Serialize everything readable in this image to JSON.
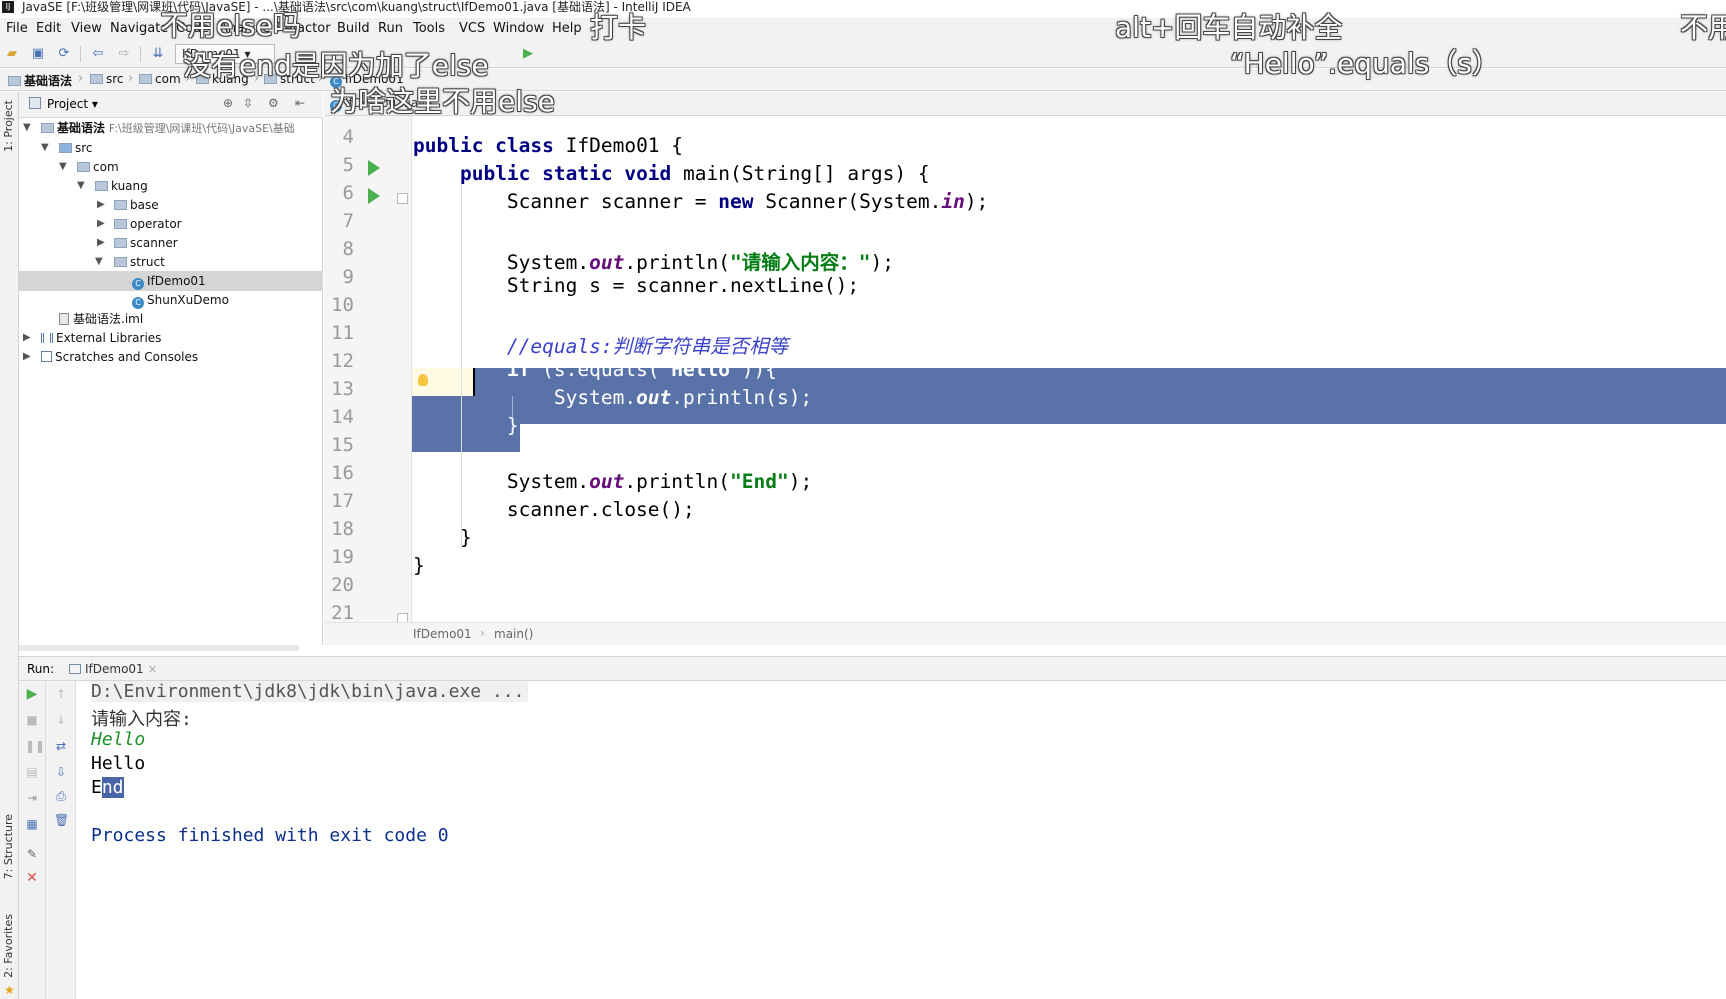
{
  "window": {
    "title": "JavaSE [F:\\班级管理\\网课班\\代码\\JavaSE] - ...\\基础语法\\src\\com\\kuang\\struct\\IfDemo01.java [基础语法] - IntelliJ IDEA"
  },
  "menu": [
    "File",
    "Edit",
    "View",
    "Navigate",
    "Code",
    "Analyze",
    "Refactor",
    "Build",
    "Run",
    "Tools",
    "VCS",
    "Window",
    "Help"
  ],
  "toolbar": {
    "run_config": "IfDemo01"
  },
  "breadcrumb": [
    "基础语法",
    "src",
    "com",
    "kuang",
    "struct",
    "IfDemo01"
  ],
  "left_tool_tabs": [
    "1: Project",
    "7: Structure",
    "2: Favorites"
  ],
  "project_panel": {
    "title": "Project",
    "tree": [
      {
        "label": "基础语法",
        "hint": "F:\\班级管理\\网课班\\代码\\JavaSE\\基础",
        "icon": "folder-icon",
        "expanded": true,
        "selected": false
      },
      {
        "label": "src",
        "hint": "",
        "icon": "folder-icon",
        "expanded": true,
        "selected": false
      },
      {
        "label": "com",
        "hint": "",
        "icon": "folder-icon",
        "expanded": true,
        "selected": false
      },
      {
        "label": "kuang",
        "hint": "",
        "icon": "folder-icon",
        "expanded": true,
        "selected": false
      },
      {
        "label": "base",
        "hint": "",
        "icon": "folder-icon",
        "expanded": false,
        "selected": false
      },
      {
        "label": "operator",
        "hint": "",
        "icon": "folder-icon",
        "expanded": false,
        "selected": false
      },
      {
        "label": "scanner",
        "hint": "",
        "icon": "folder-icon",
        "expanded": false,
        "selected": false
      },
      {
        "label": "struct",
        "hint": "",
        "icon": "folder-icon",
        "expanded": true,
        "selected": false
      },
      {
        "label": "IfDemo01",
        "hint": "",
        "icon": "java-class-icon",
        "expanded": null,
        "selected": true
      },
      {
        "label": "ShunXuDemo",
        "hint": "",
        "icon": "java-class-icon",
        "expanded": null,
        "selected": false
      },
      {
        "label": "基础语法.iml",
        "hint": "",
        "icon": "iml-file-icon",
        "expanded": null,
        "selected": false
      },
      {
        "label": "External Libraries",
        "hint": "",
        "icon": "library-icon",
        "expanded": false,
        "selected": false
      },
      {
        "label": "Scratches and Consoles",
        "hint": "",
        "icon": "scratches-icon",
        "expanded": false,
        "selected": false
      }
    ]
  },
  "editor": {
    "tab": "IfDemo01.java",
    "line_numbers": [
      "4",
      "5",
      "6",
      "7",
      "8",
      "9",
      "10",
      "11",
      "12",
      "13",
      "14",
      "15",
      "16",
      "17",
      "18",
      "19",
      "20",
      "21"
    ],
    "breadcrumbs": [
      "IfDemo01",
      "main()"
    ]
  },
  "run_panel": {
    "label": "Run:",
    "tab": "IfDemo01",
    "output": [
      "D:\\Environment\\jdk8\\jdk\\bin\\java.exe ...",
      "请输入内容:",
      "Hello",
      "Hello",
      "End",
      "Process finished with exit code 0"
    ]
  },
  "overlays": {
    "top_left": [
      "不用else吗",
      "没有end是因为加了else",
      "为啥这里不用else"
    ],
    "top_center": "打卡",
    "top_right": [
      "alt+回车自动补全",
      "“Hello”.equals（s）"
    ],
    "top_edge": "不用"
  },
  "colors": {
    "selection": "#5973a8",
    "keyword": "#000080",
    "string": "#067d17",
    "comment": "#3b42c9",
    "field": "#660e7a",
    "run_icon": "#4caf50"
  }
}
